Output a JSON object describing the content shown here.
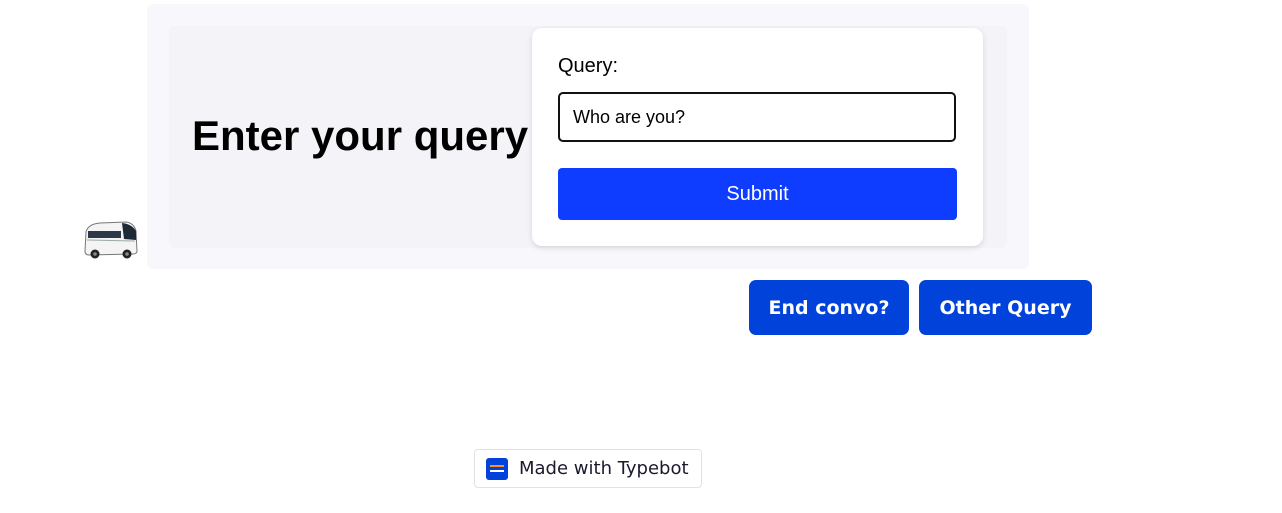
{
  "chat": {
    "heading": "Enter your query",
    "form": {
      "label": "Query:",
      "input_value": "Who are you?",
      "submit_label": "Submit"
    }
  },
  "choices": {
    "end_label": "End convo?",
    "other_label": "Other Query"
  },
  "badge": {
    "text": "Made with Typebot"
  },
  "colors": {
    "primary_button": "#0f3dff",
    "choice_button": "#0042da",
    "bubble_background": "#f7f7fc"
  },
  "icons": {
    "avatar": "bus-avatar-icon",
    "badge_logo": "typebot-logo-icon"
  }
}
